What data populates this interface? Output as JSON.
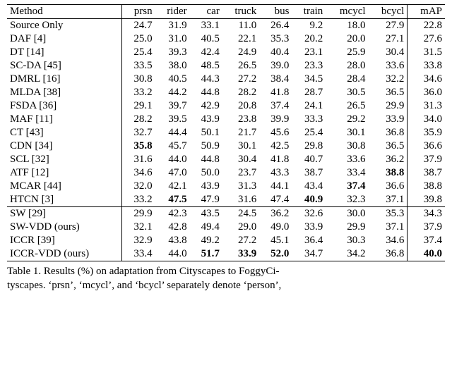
{
  "chart_data": {
    "type": "table",
    "columns": [
      "Method",
      "prsn",
      "rider",
      "car",
      "truck",
      "bus",
      "train",
      "mcycl",
      "bcycl",
      "mAP"
    ],
    "section1": [
      {
        "m": "Source Only",
        "v": [
          24.7,
          31.9,
          33.1,
          11.0,
          26.4,
          9.2,
          18.0,
          27.9,
          22.8
        ]
      },
      {
        "m": "DAF [4]",
        "v": [
          25.0,
          31.0,
          40.5,
          22.1,
          35.3,
          20.2,
          20.0,
          27.1,
          27.6
        ]
      },
      {
        "m": "DT [14]",
        "v": [
          25.4,
          39.3,
          42.4,
          24.9,
          40.4,
          23.1,
          25.9,
          30.4,
          31.5
        ]
      },
      {
        "m": "SC-DA [45]",
        "v": [
          33.5,
          38.0,
          48.5,
          26.5,
          39.0,
          23.3,
          28.0,
          33.6,
          33.8
        ]
      },
      {
        "m": "DMRL [16]",
        "v": [
          30.8,
          40.5,
          44.3,
          27.2,
          38.4,
          34.5,
          28.4,
          32.2,
          34.6
        ]
      },
      {
        "m": "MLDA [38]",
        "v": [
          33.2,
          44.2,
          44.8,
          28.2,
          41.8,
          28.7,
          30.5,
          36.5,
          36.0
        ]
      },
      {
        "m": "FSDA [36]",
        "v": [
          29.1,
          39.7,
          42.9,
          20.8,
          37.4,
          24.1,
          26.5,
          29.9,
          31.3
        ]
      },
      {
        "m": "MAF [11]",
        "v": [
          28.2,
          39.5,
          43.9,
          23.8,
          39.9,
          33.3,
          29.2,
          33.9,
          34.0
        ]
      },
      {
        "m": "CT [43]",
        "v": [
          32.7,
          44.4,
          50.1,
          21.7,
          45.6,
          25.4,
          30.1,
          36.8,
          35.9
        ]
      },
      {
        "m": "CDN [34]",
        "v": [
          35.8,
          45.7,
          50.9,
          30.1,
          42.5,
          29.8,
          30.8,
          36.5,
          36.6
        ]
      },
      {
        "m": "SCL [32]",
        "v": [
          31.6,
          44.0,
          44.8,
          30.4,
          41.8,
          40.7,
          33.6,
          36.2,
          37.9
        ]
      },
      {
        "m": "ATF [12]",
        "v": [
          34.6,
          47.0,
          50.0,
          23.7,
          43.3,
          38.7,
          33.4,
          38.8,
          38.7
        ]
      },
      {
        "m": "MCAR [44]",
        "v": [
          32.0,
          42.1,
          43.9,
          31.3,
          44.1,
          43.4,
          37.4,
          36.6,
          38.8
        ]
      },
      {
        "m": "HTCN [3]",
        "v": [
          33.2,
          47.5,
          47.9,
          31.6,
          47.4,
          40.9,
          32.3,
          37.1,
          39.8
        ]
      }
    ],
    "section2": [
      {
        "m": "SW [29]",
        "v": [
          29.9,
          42.3,
          43.5,
          24.5,
          36.2,
          32.6,
          30.0,
          35.3,
          34.3
        ]
      },
      {
        "m": "SW-VDD (ours)",
        "v": [
          32.1,
          42.8,
          49.4,
          29.0,
          49.0,
          33.9,
          29.9,
          37.1,
          37.9
        ]
      },
      {
        "m": "ICCR [39]",
        "v": [
          32.9,
          43.8,
          49.2,
          27.2,
          45.1,
          36.4,
          30.3,
          34.6,
          37.4
        ]
      },
      {
        "m": "ICCR-VDD (ours)",
        "v": [
          33.4,
          44.0,
          51.7,
          33.9,
          52.0,
          34.7,
          34.2,
          36.8,
          40.0
        ]
      }
    ],
    "bold_cells": [
      [
        9,
        0
      ],
      [
        11,
        7
      ],
      [
        12,
        6
      ],
      [
        13,
        1
      ],
      [
        13,
        5
      ],
      [
        17,
        2
      ],
      [
        17,
        3
      ],
      [
        17,
        4
      ],
      [
        17,
        8
      ]
    ]
  },
  "caption_line1": "Table 1. Results (%) on adaptation from Cityscapes to FoggyCi-",
  "caption_line2": "tyscapes. ‘prsn’, ‘mcycl’, and ‘bcycl’ separately denote ‘person’,"
}
